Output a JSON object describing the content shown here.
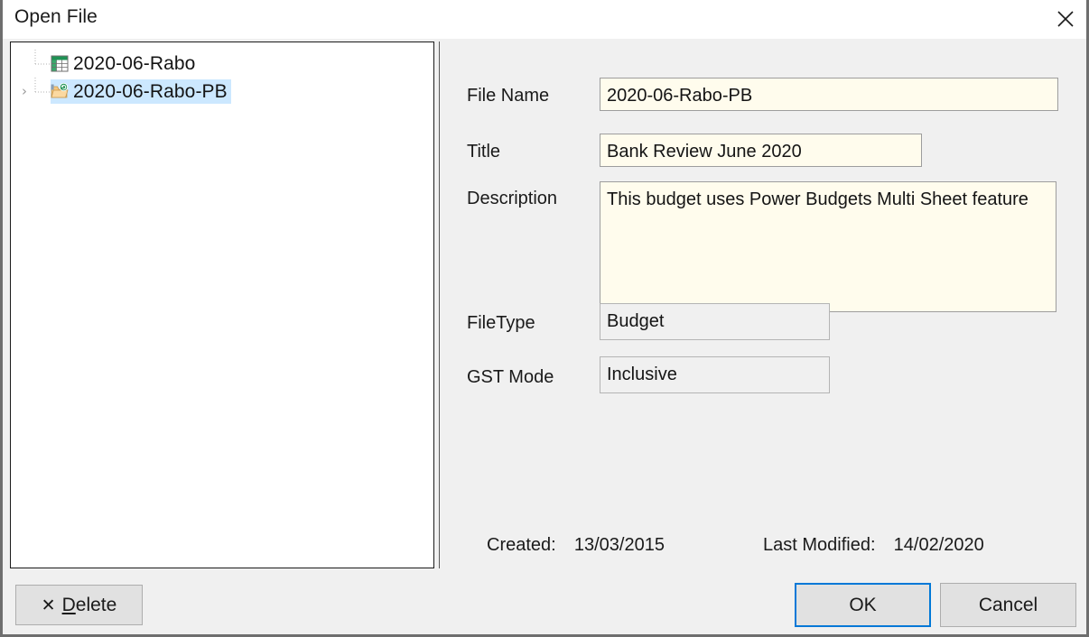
{
  "window": {
    "title": "Open File",
    "close_icon": "close-icon"
  },
  "tree": {
    "items": [
      {
        "label": "2020-06-Rabo",
        "icon": "spreadsheet-icon",
        "selected": false,
        "expander": ""
      },
      {
        "label": "2020-06-Rabo-PB",
        "icon": "folder-refresh-icon",
        "selected": true,
        "expander": "›"
      }
    ]
  },
  "details": {
    "file_name_label": "File Name",
    "file_name_value": "2020-06-Rabo-PB",
    "title_label": "Title",
    "title_value": "Bank Review June 2020",
    "description_label": "Description",
    "description_value": "This budget uses Power Budgets Multi Sheet feature",
    "filetype_label": "FileType",
    "filetype_value": "Budget",
    "gst_mode_label": "GST Mode",
    "gst_mode_value": "Inclusive",
    "created_label": "Created:",
    "created_value": "13/03/2015",
    "modified_label": "Last Modified:",
    "modified_value": "14/02/2020"
  },
  "footer": {
    "delete_x": "✕",
    "delete_mnemonic": "D",
    "delete_rest": "elete",
    "ok_label": "OK",
    "cancel_label": "Cancel"
  },
  "colors": {
    "focus_blue": "#0078d7",
    "selection_blue": "#cce8ff",
    "field_cream": "#fffced",
    "panel_grey": "#f0f0f0"
  }
}
